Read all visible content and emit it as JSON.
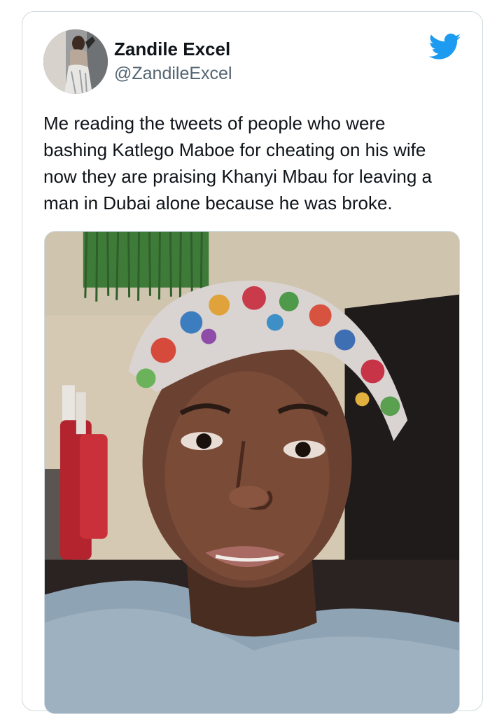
{
  "tweet": {
    "author": {
      "name": "Zandile Excel",
      "handle": "@ZandileExcel",
      "avatar_icon": "profile-photo"
    },
    "logo_icon": "twitter-bird-icon",
    "brand_color": "#1d9bf0",
    "text_lines": [
      "Me reading the tweets of people who were",
      "bashing Katlego Maboe for cheating on his wife",
      "now they are praising Khanyi Mbau for leaving a",
      "man in Dubai alone because he was broke."
    ],
    "media": {
      "kind": "photo"
    }
  }
}
